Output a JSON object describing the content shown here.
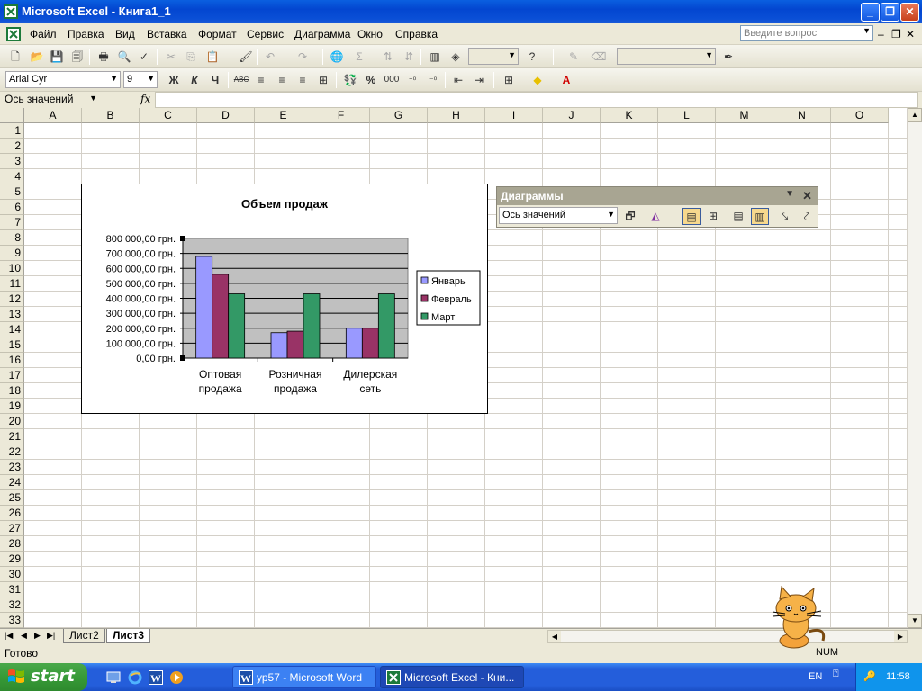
{
  "window": {
    "title": "Microsoft Excel - Книга1_1"
  },
  "menu": {
    "items": [
      "Файл",
      "Правка",
      "Вид",
      "Вставка",
      "Формат",
      "Сервис",
      "Диаграмма",
      "Окно",
      "Справка"
    ],
    "ask_placeholder": "Введите вопрос"
  },
  "format_toolbar": {
    "font": "Arial Cyr",
    "size": "9",
    "bold": "Ж",
    "italic": "К",
    "underline": "Ч",
    "percent": "%",
    "thousands": "000"
  },
  "formula_bar": {
    "name_box": "Ось значений",
    "fx": "fx"
  },
  "columns": [
    "A",
    "B",
    "C",
    "D",
    "E",
    "F",
    "G",
    "H",
    "I",
    "J",
    "K",
    "L",
    "M",
    "N",
    "O"
  ],
  "rows": [
    "1",
    "2",
    "3",
    "4",
    "5",
    "6",
    "7",
    "8",
    "9",
    "10",
    "11",
    "12",
    "13",
    "14",
    "15",
    "16",
    "17",
    "18",
    "19",
    "20",
    "21",
    "22",
    "23",
    "24",
    "25",
    "26",
    "27",
    "28",
    "29",
    "30",
    "31",
    "32",
    "33"
  ],
  "chart_data": {
    "type": "bar",
    "title": "Объем продаж",
    "categories": [
      "Оптовая продажа",
      "Розничная продажа",
      "Дилерская сеть"
    ],
    "category_lines": [
      [
        "Оптовая",
        "продажа"
      ],
      [
        "Розничная",
        "продажа"
      ],
      [
        "Дилерская",
        "сеть"
      ]
    ],
    "series": [
      {
        "name": "Январь",
        "values": [
          680000,
          170000,
          200000
        ],
        "color": "#9999ff"
      },
      {
        "name": "Февраль",
        "values": [
          560000,
          180000,
          200000
        ],
        "color": "#993366"
      },
      {
        "name": "Март",
        "values": [
          430000,
          430000,
          430000
        ],
        "color": "#339966"
      }
    ],
    "ylim": [
      0,
      800000
    ],
    "ytick_labels": [
      "0,00 грн.",
      "100 000,00 грн.",
      "200 000,00 грн.",
      "300 000,00 грн.",
      "400 000,00 грн.",
      "500 000,00 грн.",
      "600 000,00 грн.",
      "700 000,00 грн.",
      "800 000,00 грн."
    ],
    "plot_background": "#c0c0c0",
    "grid": true,
    "legend": "right"
  },
  "chart_toolbar": {
    "title": "Диаграммы",
    "object": "Ось значений"
  },
  "sheets": {
    "tabs": [
      "Лист2",
      "Лист3"
    ],
    "active": "Лист3"
  },
  "status": {
    "text": "Готово",
    "num": "NUM"
  },
  "taskbar": {
    "start": "start",
    "tasks": [
      "ур57 - Microsoft Word",
      "Microsoft Excel - Кни..."
    ],
    "lang": "EN",
    "clock": "11:58"
  }
}
